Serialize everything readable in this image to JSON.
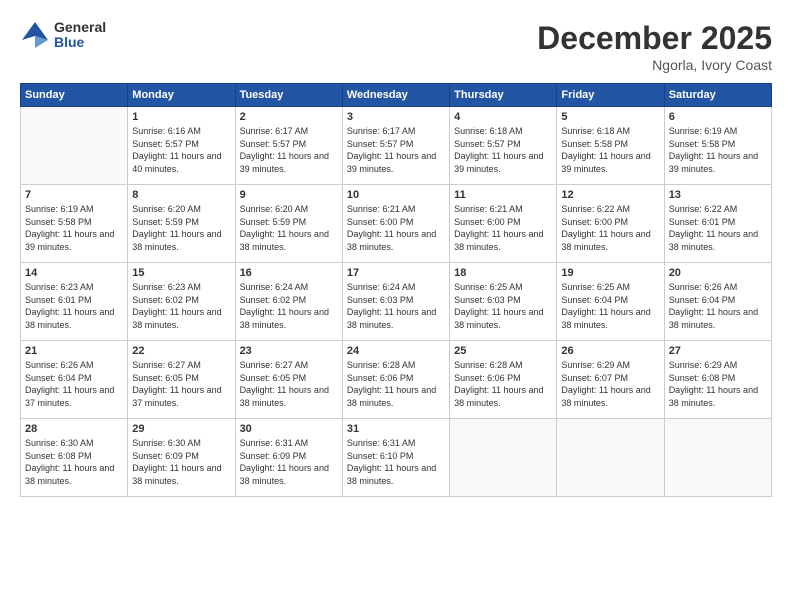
{
  "logo": {
    "general": "General",
    "blue": "Blue"
  },
  "header": {
    "title": "December 2025",
    "location": "Ngorla, Ivory Coast"
  },
  "weekdays": [
    "Sunday",
    "Monday",
    "Tuesday",
    "Wednesday",
    "Thursday",
    "Friday",
    "Saturday"
  ],
  "weeks": [
    [
      {
        "day": "",
        "sunrise": "",
        "sunset": "",
        "daylight": ""
      },
      {
        "day": "1",
        "sunrise": "Sunrise: 6:16 AM",
        "sunset": "Sunset: 5:57 PM",
        "daylight": "Daylight: 11 hours and 40 minutes."
      },
      {
        "day": "2",
        "sunrise": "Sunrise: 6:17 AM",
        "sunset": "Sunset: 5:57 PM",
        "daylight": "Daylight: 11 hours and 39 minutes."
      },
      {
        "day": "3",
        "sunrise": "Sunrise: 6:17 AM",
        "sunset": "Sunset: 5:57 PM",
        "daylight": "Daylight: 11 hours and 39 minutes."
      },
      {
        "day": "4",
        "sunrise": "Sunrise: 6:18 AM",
        "sunset": "Sunset: 5:57 PM",
        "daylight": "Daylight: 11 hours and 39 minutes."
      },
      {
        "day": "5",
        "sunrise": "Sunrise: 6:18 AM",
        "sunset": "Sunset: 5:58 PM",
        "daylight": "Daylight: 11 hours and 39 minutes."
      },
      {
        "day": "6",
        "sunrise": "Sunrise: 6:19 AM",
        "sunset": "Sunset: 5:58 PM",
        "daylight": "Daylight: 11 hours and 39 minutes."
      }
    ],
    [
      {
        "day": "7",
        "sunrise": "Sunrise: 6:19 AM",
        "sunset": "Sunset: 5:58 PM",
        "daylight": "Daylight: 11 hours and 39 minutes."
      },
      {
        "day": "8",
        "sunrise": "Sunrise: 6:20 AM",
        "sunset": "Sunset: 5:59 PM",
        "daylight": "Daylight: 11 hours and 38 minutes."
      },
      {
        "day": "9",
        "sunrise": "Sunrise: 6:20 AM",
        "sunset": "Sunset: 5:59 PM",
        "daylight": "Daylight: 11 hours and 38 minutes."
      },
      {
        "day": "10",
        "sunrise": "Sunrise: 6:21 AM",
        "sunset": "Sunset: 6:00 PM",
        "daylight": "Daylight: 11 hours and 38 minutes."
      },
      {
        "day": "11",
        "sunrise": "Sunrise: 6:21 AM",
        "sunset": "Sunset: 6:00 PM",
        "daylight": "Daylight: 11 hours and 38 minutes."
      },
      {
        "day": "12",
        "sunrise": "Sunrise: 6:22 AM",
        "sunset": "Sunset: 6:00 PM",
        "daylight": "Daylight: 11 hours and 38 minutes."
      },
      {
        "day": "13",
        "sunrise": "Sunrise: 6:22 AM",
        "sunset": "Sunset: 6:01 PM",
        "daylight": "Daylight: 11 hours and 38 minutes."
      }
    ],
    [
      {
        "day": "14",
        "sunrise": "Sunrise: 6:23 AM",
        "sunset": "Sunset: 6:01 PM",
        "daylight": "Daylight: 11 hours and 38 minutes."
      },
      {
        "day": "15",
        "sunrise": "Sunrise: 6:23 AM",
        "sunset": "Sunset: 6:02 PM",
        "daylight": "Daylight: 11 hours and 38 minutes."
      },
      {
        "day": "16",
        "sunrise": "Sunrise: 6:24 AM",
        "sunset": "Sunset: 6:02 PM",
        "daylight": "Daylight: 11 hours and 38 minutes."
      },
      {
        "day": "17",
        "sunrise": "Sunrise: 6:24 AM",
        "sunset": "Sunset: 6:03 PM",
        "daylight": "Daylight: 11 hours and 38 minutes."
      },
      {
        "day": "18",
        "sunrise": "Sunrise: 6:25 AM",
        "sunset": "Sunset: 6:03 PM",
        "daylight": "Daylight: 11 hours and 38 minutes."
      },
      {
        "day": "19",
        "sunrise": "Sunrise: 6:25 AM",
        "sunset": "Sunset: 6:04 PM",
        "daylight": "Daylight: 11 hours and 38 minutes."
      },
      {
        "day": "20",
        "sunrise": "Sunrise: 6:26 AM",
        "sunset": "Sunset: 6:04 PM",
        "daylight": "Daylight: 11 hours and 38 minutes."
      }
    ],
    [
      {
        "day": "21",
        "sunrise": "Sunrise: 6:26 AM",
        "sunset": "Sunset: 6:04 PM",
        "daylight": "Daylight: 11 hours and 37 minutes."
      },
      {
        "day": "22",
        "sunrise": "Sunrise: 6:27 AM",
        "sunset": "Sunset: 6:05 PM",
        "daylight": "Daylight: 11 hours and 37 minutes."
      },
      {
        "day": "23",
        "sunrise": "Sunrise: 6:27 AM",
        "sunset": "Sunset: 6:05 PM",
        "daylight": "Daylight: 11 hours and 38 minutes."
      },
      {
        "day": "24",
        "sunrise": "Sunrise: 6:28 AM",
        "sunset": "Sunset: 6:06 PM",
        "daylight": "Daylight: 11 hours and 38 minutes."
      },
      {
        "day": "25",
        "sunrise": "Sunrise: 6:28 AM",
        "sunset": "Sunset: 6:06 PM",
        "daylight": "Daylight: 11 hours and 38 minutes."
      },
      {
        "day": "26",
        "sunrise": "Sunrise: 6:29 AM",
        "sunset": "Sunset: 6:07 PM",
        "daylight": "Daylight: 11 hours and 38 minutes."
      },
      {
        "day": "27",
        "sunrise": "Sunrise: 6:29 AM",
        "sunset": "Sunset: 6:08 PM",
        "daylight": "Daylight: 11 hours and 38 minutes."
      }
    ],
    [
      {
        "day": "28",
        "sunrise": "Sunrise: 6:30 AM",
        "sunset": "Sunset: 6:08 PM",
        "daylight": "Daylight: 11 hours and 38 minutes."
      },
      {
        "day": "29",
        "sunrise": "Sunrise: 6:30 AM",
        "sunset": "Sunset: 6:09 PM",
        "daylight": "Daylight: 11 hours and 38 minutes."
      },
      {
        "day": "30",
        "sunrise": "Sunrise: 6:31 AM",
        "sunset": "Sunset: 6:09 PM",
        "daylight": "Daylight: 11 hours and 38 minutes."
      },
      {
        "day": "31",
        "sunrise": "Sunrise: 6:31 AM",
        "sunset": "Sunset: 6:10 PM",
        "daylight": "Daylight: 11 hours and 38 minutes."
      },
      {
        "day": "",
        "sunrise": "",
        "sunset": "",
        "daylight": ""
      },
      {
        "day": "",
        "sunrise": "",
        "sunset": "",
        "daylight": ""
      },
      {
        "day": "",
        "sunrise": "",
        "sunset": "",
        "daylight": ""
      }
    ]
  ]
}
